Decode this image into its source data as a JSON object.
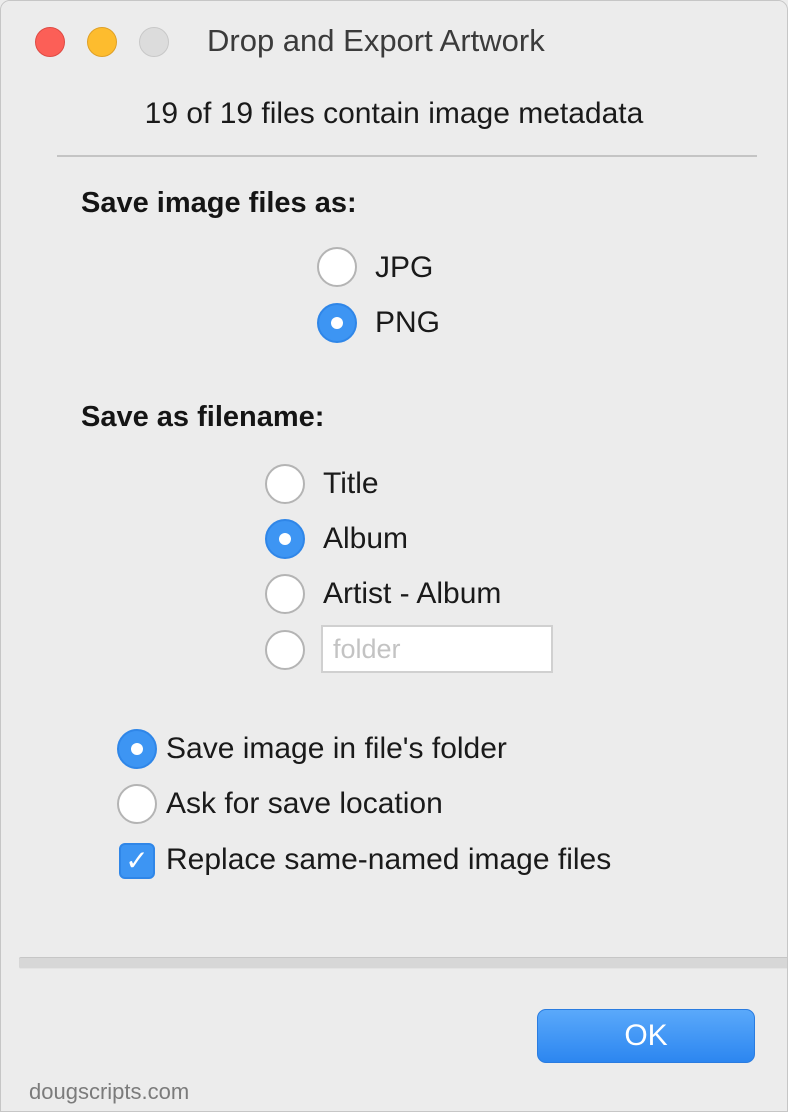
{
  "window": {
    "title": "Drop and Export Artwork"
  },
  "header": {
    "status_text": "19 of 19 files contain image metadata"
  },
  "image_format": {
    "heading": "Save image files as:",
    "options": [
      {
        "label": "JPG",
        "selected": false
      },
      {
        "label": "PNG",
        "selected": true
      }
    ]
  },
  "filename": {
    "heading": "Save as filename:",
    "options": [
      {
        "label": "Title",
        "selected": false
      },
      {
        "label": "Album",
        "selected": true
      },
      {
        "label": "Artist - Album",
        "selected": false
      }
    ],
    "custom_field": {
      "value": "",
      "placeholder": "folder",
      "selected": false
    }
  },
  "location": {
    "options": [
      {
        "label": "Save image in file's folder",
        "selected": true
      },
      {
        "label": "Ask for save location",
        "selected": false
      }
    ],
    "replace_checkbox": {
      "label": "Replace same-named image files",
      "checked": true
    }
  },
  "buttons": {
    "ok_label": "OK"
  },
  "footer": {
    "credit": "dougscripts.com"
  },
  "colors": {
    "accent": "#3d95f3",
    "close": "#fc5f57",
    "minimize": "#fdbc2e",
    "zoom_disabled": "#dcdcdc"
  }
}
